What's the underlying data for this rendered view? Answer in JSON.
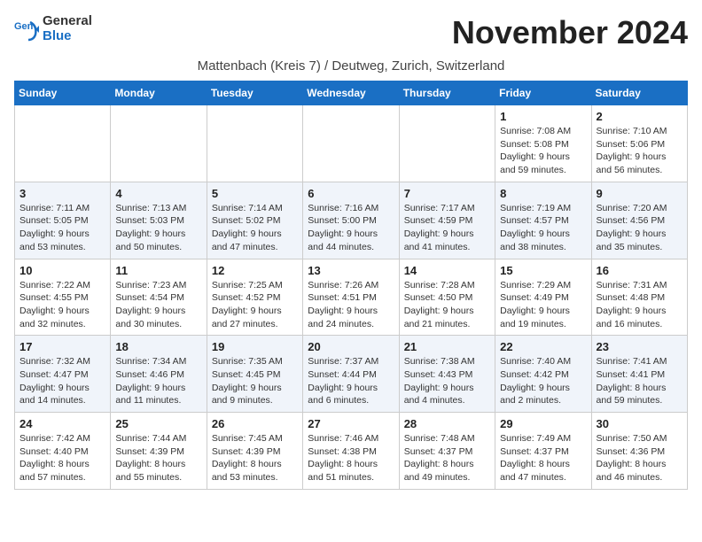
{
  "header": {
    "logo_line1": "General",
    "logo_line2": "Blue",
    "month_title": "November 2024",
    "location": "Mattenbach (Kreis 7) / Deutweg, Zurich, Switzerland"
  },
  "weekdays": [
    "Sunday",
    "Monday",
    "Tuesday",
    "Wednesday",
    "Thursday",
    "Friday",
    "Saturday"
  ],
  "rows": [
    [
      {
        "day": "",
        "info": ""
      },
      {
        "day": "",
        "info": ""
      },
      {
        "day": "",
        "info": ""
      },
      {
        "day": "",
        "info": ""
      },
      {
        "day": "",
        "info": ""
      },
      {
        "day": "1",
        "info": "Sunrise: 7:08 AM\nSunset: 5:08 PM\nDaylight: 9 hours and 59 minutes."
      },
      {
        "day": "2",
        "info": "Sunrise: 7:10 AM\nSunset: 5:06 PM\nDaylight: 9 hours and 56 minutes."
      }
    ],
    [
      {
        "day": "3",
        "info": "Sunrise: 7:11 AM\nSunset: 5:05 PM\nDaylight: 9 hours and 53 minutes."
      },
      {
        "day": "4",
        "info": "Sunrise: 7:13 AM\nSunset: 5:03 PM\nDaylight: 9 hours and 50 minutes."
      },
      {
        "day": "5",
        "info": "Sunrise: 7:14 AM\nSunset: 5:02 PM\nDaylight: 9 hours and 47 minutes."
      },
      {
        "day": "6",
        "info": "Sunrise: 7:16 AM\nSunset: 5:00 PM\nDaylight: 9 hours and 44 minutes."
      },
      {
        "day": "7",
        "info": "Sunrise: 7:17 AM\nSunset: 4:59 PM\nDaylight: 9 hours and 41 minutes."
      },
      {
        "day": "8",
        "info": "Sunrise: 7:19 AM\nSunset: 4:57 PM\nDaylight: 9 hours and 38 minutes."
      },
      {
        "day": "9",
        "info": "Sunrise: 7:20 AM\nSunset: 4:56 PM\nDaylight: 9 hours and 35 minutes."
      }
    ],
    [
      {
        "day": "10",
        "info": "Sunrise: 7:22 AM\nSunset: 4:55 PM\nDaylight: 9 hours and 32 minutes."
      },
      {
        "day": "11",
        "info": "Sunrise: 7:23 AM\nSunset: 4:54 PM\nDaylight: 9 hours and 30 minutes."
      },
      {
        "day": "12",
        "info": "Sunrise: 7:25 AM\nSunset: 4:52 PM\nDaylight: 9 hours and 27 minutes."
      },
      {
        "day": "13",
        "info": "Sunrise: 7:26 AM\nSunset: 4:51 PM\nDaylight: 9 hours and 24 minutes."
      },
      {
        "day": "14",
        "info": "Sunrise: 7:28 AM\nSunset: 4:50 PM\nDaylight: 9 hours and 21 minutes."
      },
      {
        "day": "15",
        "info": "Sunrise: 7:29 AM\nSunset: 4:49 PM\nDaylight: 9 hours and 19 minutes."
      },
      {
        "day": "16",
        "info": "Sunrise: 7:31 AM\nSunset: 4:48 PM\nDaylight: 9 hours and 16 minutes."
      }
    ],
    [
      {
        "day": "17",
        "info": "Sunrise: 7:32 AM\nSunset: 4:47 PM\nDaylight: 9 hours and 14 minutes."
      },
      {
        "day": "18",
        "info": "Sunrise: 7:34 AM\nSunset: 4:46 PM\nDaylight: 9 hours and 11 minutes."
      },
      {
        "day": "19",
        "info": "Sunrise: 7:35 AM\nSunset: 4:45 PM\nDaylight: 9 hours and 9 minutes."
      },
      {
        "day": "20",
        "info": "Sunrise: 7:37 AM\nSunset: 4:44 PM\nDaylight: 9 hours and 6 minutes."
      },
      {
        "day": "21",
        "info": "Sunrise: 7:38 AM\nSunset: 4:43 PM\nDaylight: 9 hours and 4 minutes."
      },
      {
        "day": "22",
        "info": "Sunrise: 7:40 AM\nSunset: 4:42 PM\nDaylight: 9 hours and 2 minutes."
      },
      {
        "day": "23",
        "info": "Sunrise: 7:41 AM\nSunset: 4:41 PM\nDaylight: 8 hours and 59 minutes."
      }
    ],
    [
      {
        "day": "24",
        "info": "Sunrise: 7:42 AM\nSunset: 4:40 PM\nDaylight: 8 hours and 57 minutes."
      },
      {
        "day": "25",
        "info": "Sunrise: 7:44 AM\nSunset: 4:39 PM\nDaylight: 8 hours and 55 minutes."
      },
      {
        "day": "26",
        "info": "Sunrise: 7:45 AM\nSunset: 4:39 PM\nDaylight: 8 hours and 53 minutes."
      },
      {
        "day": "27",
        "info": "Sunrise: 7:46 AM\nSunset: 4:38 PM\nDaylight: 8 hours and 51 minutes."
      },
      {
        "day": "28",
        "info": "Sunrise: 7:48 AM\nSunset: 4:37 PM\nDaylight: 8 hours and 49 minutes."
      },
      {
        "day": "29",
        "info": "Sunrise: 7:49 AM\nSunset: 4:37 PM\nDaylight: 8 hours and 47 minutes."
      },
      {
        "day": "30",
        "info": "Sunrise: 7:50 AM\nSunset: 4:36 PM\nDaylight: 8 hours and 46 minutes."
      }
    ]
  ]
}
